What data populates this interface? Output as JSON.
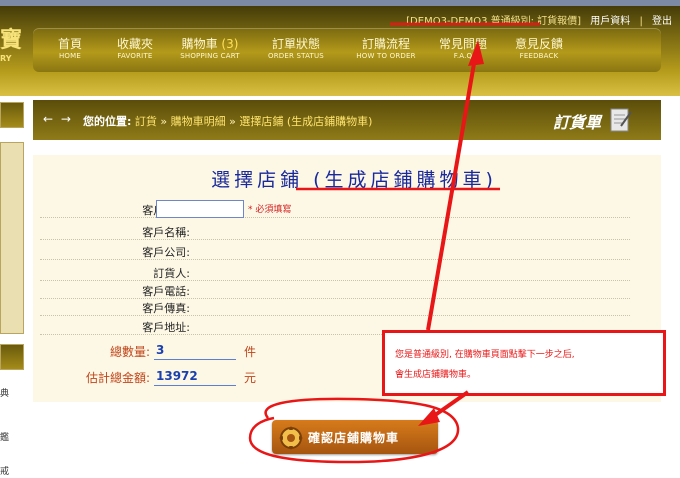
{
  "header": {
    "logo_text": "寶",
    "logo_sub": "RY",
    "account_info": "[DEMO3-DEMO3 普通級別: 訂貨報價]",
    "account_link": "用戶資料",
    "separator": "|",
    "logout": "登出"
  },
  "nav": [
    {
      "zh": "首頁",
      "en": "HOME"
    },
    {
      "zh": "收藏夾",
      "en": "FAVORITE"
    },
    {
      "zh": "購物車",
      "count": "(3)",
      "en": "SHOPPING CART"
    },
    {
      "zh": "訂單狀態",
      "en": "ORDER STATUS"
    },
    {
      "zh": "訂購流程",
      "en": "HOW TO ORDER"
    },
    {
      "zh": "常見問題",
      "en": "F.A.Q"
    },
    {
      "zh": "意見反饋",
      "en": "FEEDBACK"
    }
  ],
  "breadcrumb": {
    "arrows": "← →",
    "prefix": "您的位置:",
    "items": [
      "訂貨",
      "購物車明細",
      "選擇店鋪 (生成店鋪購物車)"
    ],
    "sep": "»",
    "title": "訂貨單"
  },
  "form": {
    "page_title": "選擇店鋪 (生成店鋪購物車)",
    "customer_id_label": "客戶編號:",
    "customer_id_value": "",
    "required_note": "* 必須填寫",
    "fields": [
      {
        "label": "客戶名稱:"
      },
      {
        "label": "客戶公司:"
      },
      {
        "label": "訂貨人:"
      },
      {
        "label": "客戶電話:"
      },
      {
        "label": "客戶傳真:"
      },
      {
        "label": "客戶地址:"
      }
    ],
    "total_qty_label": "總數量:",
    "total_qty_value": "3",
    "total_qty_unit": "件",
    "total_amount_label": "估計總金額:",
    "total_amount_value": "13972",
    "total_amount_unit": "元",
    "confirm_button": "確認店鋪購物車"
  },
  "callout": {
    "line1": "您是普通級別, 在購物車頁面點擊下一步之后,",
    "line2": "會生成店鋪購物車。"
  },
  "colors": {
    "gold_dark": "#5b4d0a",
    "gold_light": "#d9c044",
    "title_blue": "#1a2a9c",
    "annotation_red": "#e81616",
    "button_orange": "#d77b1b"
  },
  "icons": [
    "back-arrow-icon",
    "forward-arrow-icon",
    "document-icon",
    "gear-icon"
  ],
  "left_panel_fragments": [
    "典",
    "鑑",
    "戒"
  ]
}
